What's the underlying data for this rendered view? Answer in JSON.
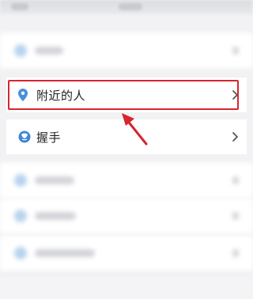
{
  "menu": {
    "nearby_people": {
      "label": "附近的人",
      "icon": "location-pin-icon"
    },
    "shake": {
      "label": "握手",
      "icon": "hand-shake-icon"
    }
  },
  "annotation": {
    "highlight_color": "#d6262e",
    "arrow_color": "#d6262e"
  },
  "colors": {
    "pin_blue": "#4a8fdd",
    "shake_blue": "#3f86d6",
    "background": "#f2f2f4"
  }
}
